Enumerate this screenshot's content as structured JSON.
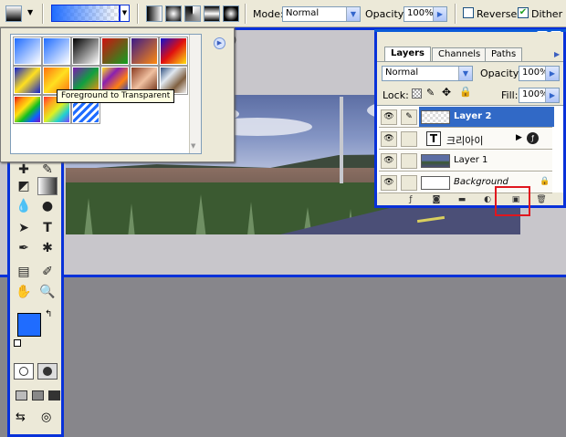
{
  "options_bar": {
    "mode_label": "Mode:",
    "mode_value": "Normal",
    "opacity_label": "Opacity:",
    "opacity_value": "100%",
    "reverse_label": "Reverse",
    "reverse_checked": false,
    "dither_label": "Dither",
    "dither_checked": true
  },
  "gradient_picker": {
    "tooltip": "Foreground to Transparent",
    "swatches": [
      {
        "name": "foreground-to-background",
        "css": "linear-gradient(135deg,#1f6cff,#ffffff)"
      },
      {
        "name": "foreground-to-transparent",
        "css": "linear-gradient(135deg,#1f6cff,rgba(255,255,255,0))"
      },
      {
        "name": "black-white",
        "css": "linear-gradient(135deg,#000,#fff)"
      },
      {
        "name": "red-green",
        "css": "linear-gradient(135deg,#d01010,#10a020)"
      },
      {
        "name": "violet-orange",
        "css": "linear-gradient(135deg,#3a1a8a,#ff8a10)"
      },
      {
        "name": "blue-red-yellow",
        "css": "linear-gradient(135deg,#1010d0,#e01010,#ffe010)"
      },
      {
        "name": "blue-yellow-blue",
        "css": "linear-gradient(135deg,#1020d0,#ffe020,#1020d0)"
      },
      {
        "name": "orange-yellow-orange",
        "css": "linear-gradient(135deg,#ff7010,#ffe020,#ff7010)"
      },
      {
        "name": "violet-green-orange",
        "css": "linear-gradient(135deg,#7a1ab0,#10a040,#ff9010)"
      },
      {
        "name": "yellow-violet-orange-blue",
        "css": "linear-gradient(135deg,#ffe020,#8a20b0,#ff8010,#1040d0)"
      },
      {
        "name": "copper",
        "css": "linear-gradient(135deg,#8a3a20,#f0c0a0,#6a2a10)"
      },
      {
        "name": "chrome",
        "css": "linear-gradient(135deg,#305080,#e0e8f0,#806040,#f0f0f0)"
      },
      {
        "name": "spectrum",
        "css": "linear-gradient(135deg,#e01010,#ff9010,#ffe010,#10c020,#1060ff,#8010c0)"
      },
      {
        "name": "transparent-rainbow",
        "css": "linear-gradient(135deg,#ff3030,#ffa020,#e0f020,#20d0d0,#8040ff)"
      },
      {
        "name": "transparent-stripes",
        "css": "repeating-linear-gradient(135deg,#1f6cff 0 3px,#ffffff 3px 6px)"
      }
    ]
  },
  "layers_panel": {
    "tabs": [
      "Layers",
      "Channels",
      "Paths"
    ],
    "blend_mode": "Normal",
    "opacity_label": "Opacity:",
    "opacity_value": "100%",
    "lock_label": "Lock:",
    "fill_label": "Fill:",
    "fill_value": "100%",
    "layers": [
      {
        "name": "Layer 2",
        "selected": true
      },
      {
        "name": "크리아이",
        "selected": false
      },
      {
        "name": "Layer 1",
        "selected": false
      },
      {
        "name": "Background",
        "selected": false
      }
    ]
  },
  "colors": {
    "foreground": "#1f6cff",
    "background": "#ffffff",
    "accent": "#0831d9",
    "highlight": "#e0161e"
  }
}
